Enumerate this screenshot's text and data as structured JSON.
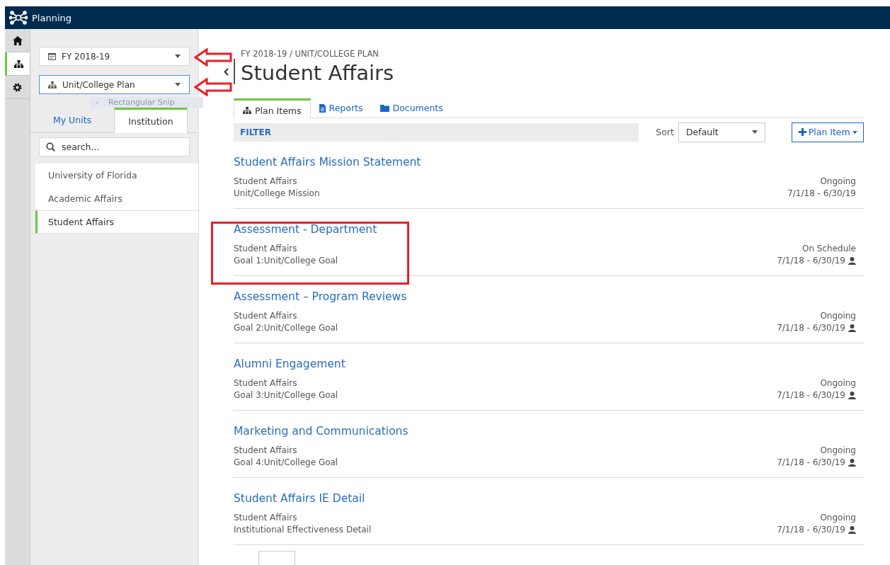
{
  "app": {
    "title": "Planning"
  },
  "rail": [
    {
      "kind": "home",
      "selected": false
    },
    {
      "kind": "hierarchy",
      "selected": true
    },
    {
      "kind": "settings",
      "selected": false
    }
  ],
  "selectors": [
    {
      "kind": "calendar",
      "value": "FY 2018-19",
      "focused": false
    },
    {
      "kind": "hierarchy",
      "value": "Unit/College Plan",
      "focused": true
    }
  ],
  "snip_tooltip": {
    "label": "Rectangular Snip"
  },
  "unit_tabs": [
    {
      "label": "My Units",
      "selected": false
    },
    {
      "label": "Institution",
      "selected": true
    }
  ],
  "search": {
    "placeholder": "search..."
  },
  "units": [
    {
      "label": "University of Florida",
      "selected": false
    },
    {
      "label": "Academic Affairs",
      "selected": false
    },
    {
      "label": "Student Affairs",
      "selected": true
    }
  ],
  "breadcrumb": "FY 2018-19 / UNIT/COLLEGE PLAN",
  "title": "Student Affairs",
  "tabs": [
    {
      "kind": "hierarchy",
      "label": "Plan Items",
      "selected": true
    },
    {
      "kind": "report",
      "label": "Reports",
      "selected": false
    },
    {
      "kind": "folder",
      "label": "Documents",
      "selected": false
    }
  ],
  "filter": {
    "label": "FILTER"
  },
  "sort": {
    "label": "Sort",
    "value": "Default"
  },
  "add_button": {
    "label": "Plan Item"
  },
  "items": [
    {
      "title": "Student Affairs Mission Statement",
      "unit": "Student Affairs",
      "detail": "Unit/College Mission",
      "status": "Ongoing",
      "dates": "7/1/18 - 6/30/19",
      "has_owner": false
    },
    {
      "title": "Assessment - Department",
      "unit": "Student Affairs",
      "detail": "Goal 1:Unit/College Goal",
      "status": "On Schedule",
      "dates": "7/1/18 - 6/30/19",
      "has_owner": true
    },
    {
      "title": "Assessment – Program Reviews",
      "unit": "Student Affairs",
      "detail": "Goal 2:Unit/College Goal",
      "status": "Ongoing",
      "dates": "7/1/18 - 6/30/19",
      "has_owner": true
    },
    {
      "title": "Alumni Engagement",
      "unit": "Student Affairs",
      "detail": "Goal 3:Unit/College Goal",
      "status": "Ongoing",
      "dates": "7/1/18 - 6/30/19",
      "has_owner": true
    },
    {
      "title": "Marketing and Communications",
      "unit": "Student Affairs",
      "detail": "Goal 4:Unit/College Goal",
      "status": "Ongoing",
      "dates": "7/1/18 - 6/30/19",
      "has_owner": true
    },
    {
      "title": "Student Affairs IE Detail",
      "unit": "Student Affairs",
      "detail": "Institutional Effectiveness Detail",
      "status": "Ongoing",
      "dates": "7/1/18 - 6/30/19",
      "has_owner": true
    }
  ]
}
